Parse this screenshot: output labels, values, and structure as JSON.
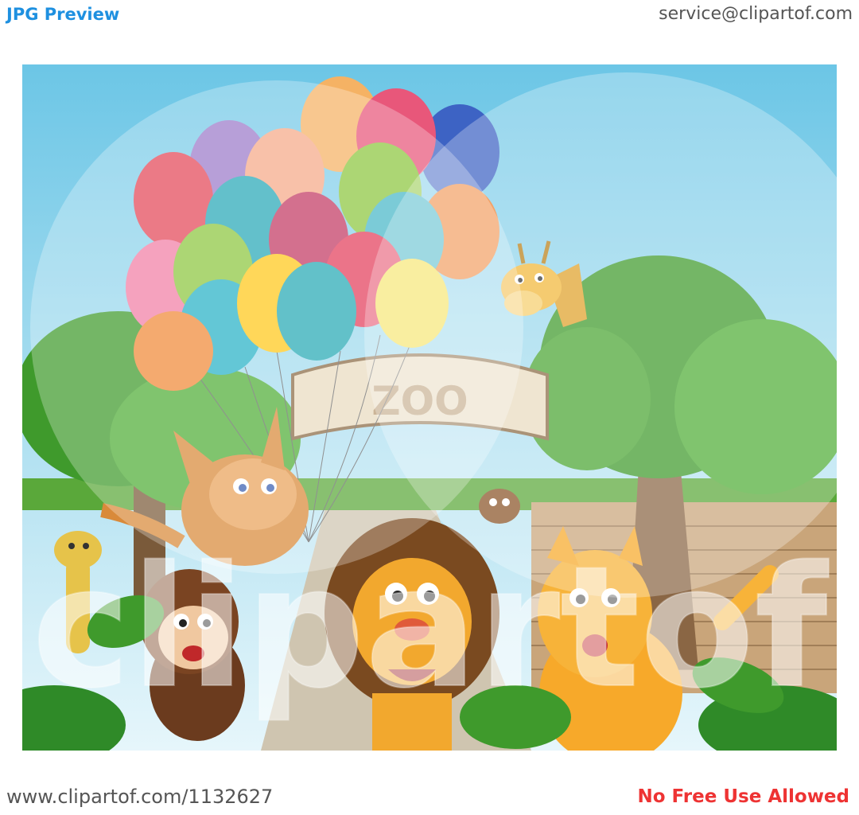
{
  "header": {
    "preview_label": "JPG Preview",
    "contact_email": "service@clipartof.com"
  },
  "illustration": {
    "sign_text": "ZOO",
    "watermark_text": "clipartof"
  },
  "footer": {
    "url": "www.clipartof.com/1132627",
    "notice": "No Free Use Allowed"
  },
  "colors": {
    "header_blue": "#1e90e0",
    "notice_red": "#ee3333",
    "sky": "#7ecbe8",
    "tree_green": "#3f9a2c"
  }
}
